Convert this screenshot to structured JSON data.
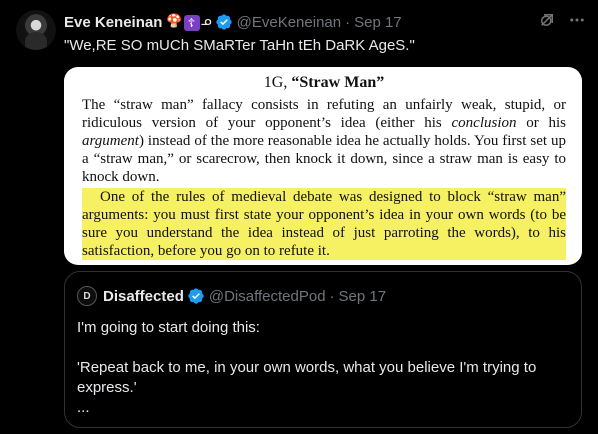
{
  "tweet": {
    "author_name": "Eve Keneinan",
    "author_emoji_1": "🍄",
    "author_emoji_2": "☦",
    "author_emoji_3": "ᓄ",
    "handle": "@EveKeneinan",
    "separator": "·",
    "date": "Sep 17",
    "text": "\"We,RE SO mUCh SMaRTer TaHn tEh DaRK AgeS.\""
  },
  "image": {
    "title_num": "1G,",
    "title_bold": "“Straw Man”",
    "para1_a": "The “straw man” fallacy consists in refuting an unfairly weak, stupid, or ridiculous version of your opponent’s idea (either his ",
    "para1_em1": "conclusion",
    "para1_b": " or his ",
    "para1_em2": "argument",
    "para1_c": ") instead of the more reasonable idea he actually holds. You first set up a “straw man,” or scarecrow, then knock it down, since a straw man is easy to knock down.",
    "para2": "One of the rules of medieval debate was designed to block “straw man” arguments: you must first state your opponent’s idea in your own words (to be sure you understand the idea instead of just parroting the words), to his satisfaction, before you go on to refute it."
  },
  "quoted": {
    "avatar_letter": "D",
    "author_name": "Disaffected",
    "handle": "@DisaffectedPod",
    "separator": "·",
    "date": "Sep 17",
    "line1": "I'm going to start doing this:",
    "line2": "",
    "line3": "'Repeat back to me, in your own words, what you believe I'm trying to express.'",
    "line4": "..."
  },
  "icons": {
    "verified": "verified-badge-icon",
    "grok": "grok-icon",
    "more": "more-options-icon"
  },
  "colors": {
    "background": "#000000",
    "text": "#e7e9ea",
    "muted": "#71767b",
    "verified_blue": "#1d9bf0",
    "highlight": "#f6f163"
  }
}
